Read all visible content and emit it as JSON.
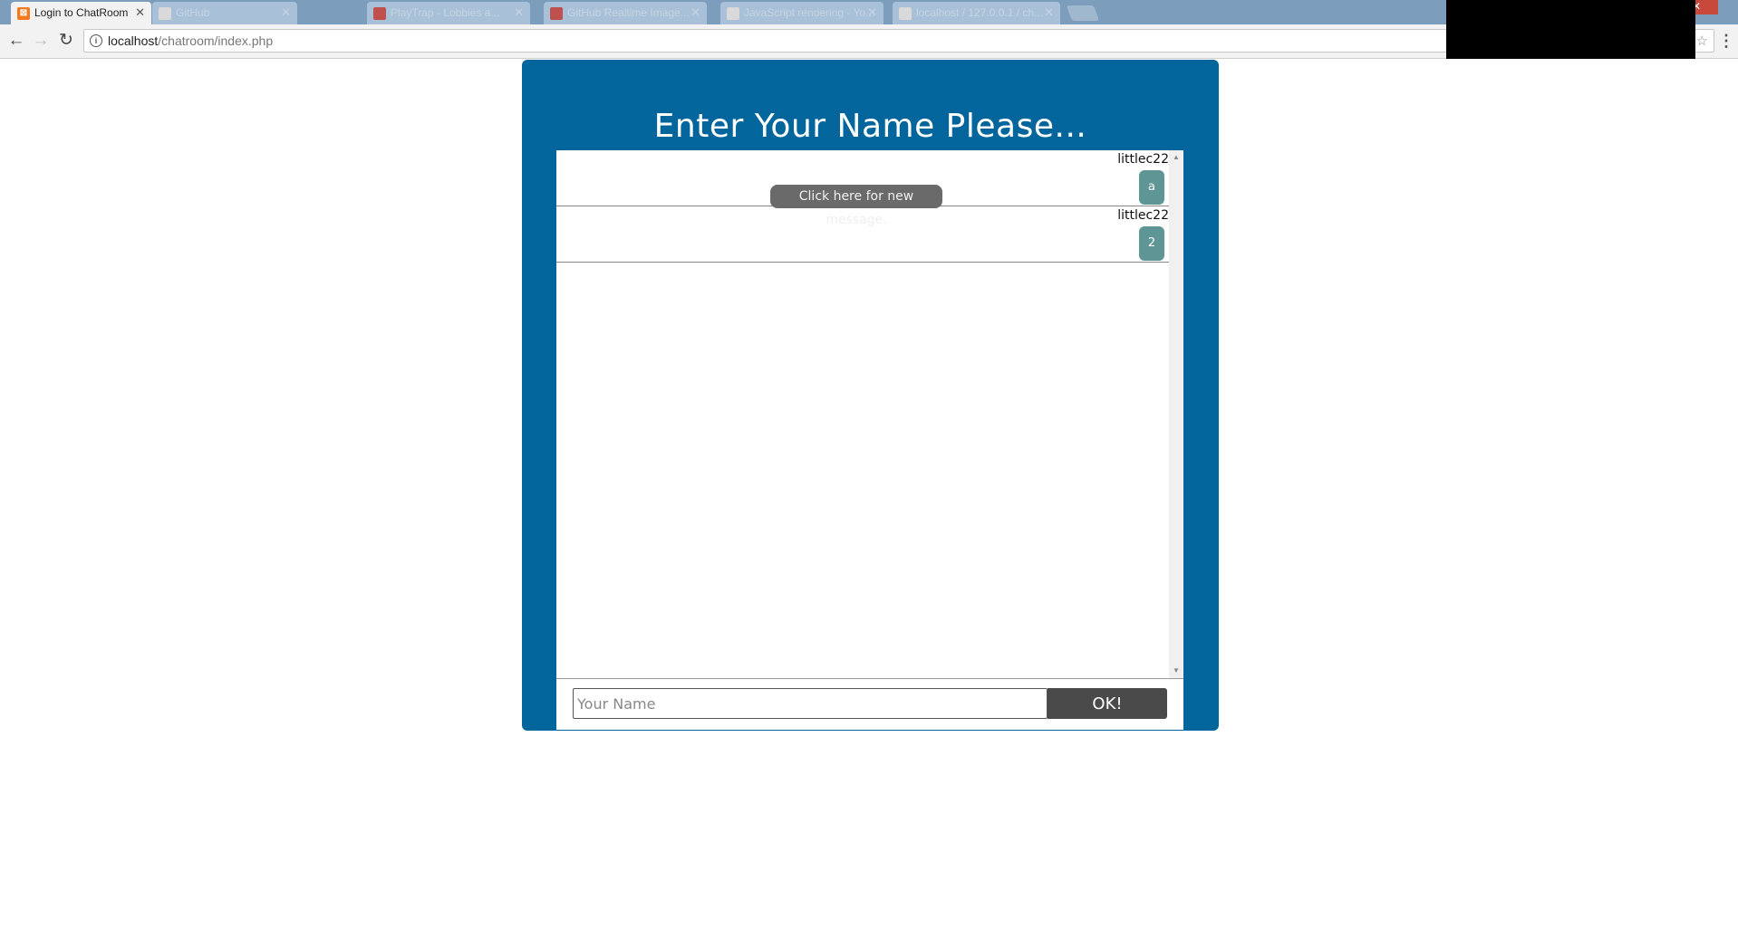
{
  "browser": {
    "tabs": [
      {
        "label": "Login to ChatRoom",
        "active": true,
        "favicon": "xampp-icon"
      },
      {
        "label": "GitHub",
        "active": false,
        "favicon": "page-icon"
      },
      {
        "label": "PlayTrap - Lobbies a...",
        "active": false,
        "favicon": "youtube-icon"
      },
      {
        "label": "GitHub Realtime Image...",
        "active": false,
        "favicon": "youtube-icon"
      },
      {
        "label": "JavaScript rendering - Yo...",
        "active": false,
        "favicon": "page-icon"
      },
      {
        "label": "localhost / 127.0.0.1 / ch...",
        "active": false,
        "favicon": "page-icon"
      }
    ],
    "tab_close_glyph": "✕",
    "window_close_glyph": "✕",
    "back_glyph": "←",
    "forward_glyph": "→",
    "reload_glyph": "↻",
    "info_glyph": "i",
    "star_glyph": "☆",
    "menu_glyph": "⋮",
    "url_host": "localhost",
    "url_path": "/chatroom/index.php"
  },
  "chat": {
    "title": "Enter Your Name Please...",
    "new_message_notice": "Click here for new message.",
    "messages": [
      {
        "author": "littlec22",
        "text": "a"
      },
      {
        "author": "littlec22",
        "text": "2"
      }
    ],
    "scroll_up_glyph": "▲",
    "scroll_down_glyph": "▼",
    "name_input": {
      "value": "",
      "placeholder": "Your Name"
    },
    "ok_label": "OK!"
  },
  "colors": {
    "panel_bg": "#02659c",
    "bubble_bg": "#5e9696",
    "button_bg": "#4a4a4a",
    "notice_bg": "#6a6a6a"
  }
}
